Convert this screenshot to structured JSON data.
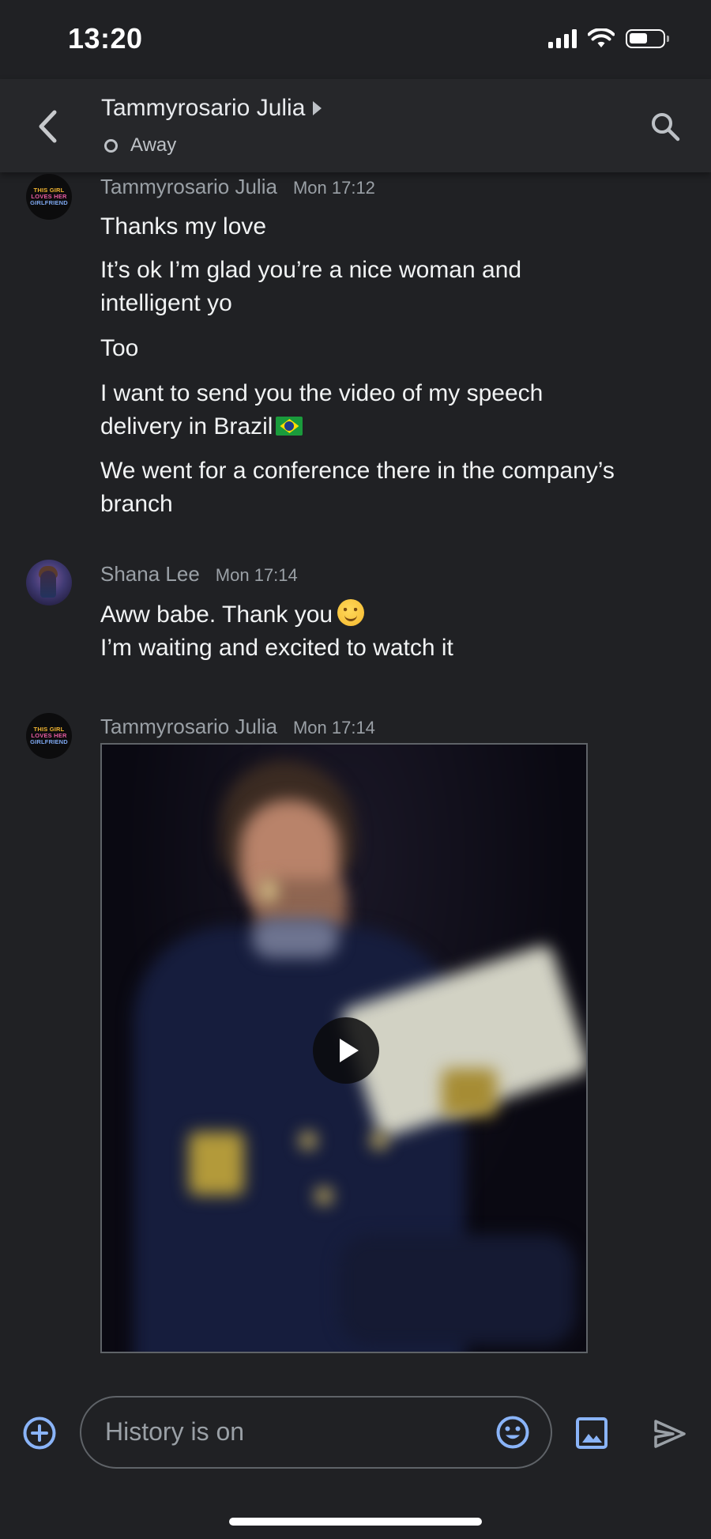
{
  "status_bar": {
    "time": "13:20"
  },
  "header": {
    "contact_name": "Tammyrosario Julia",
    "presence": "Away"
  },
  "messages": [
    {
      "sender": "Tammyrosario Julia",
      "avatar_text": [
        "THIS GIRL",
        "LOVES HER",
        "GIRLFRIEND"
      ],
      "time": "Mon 17:12",
      "lines": [
        "Thanks my love",
        "It’s ok I’m glad you’re a nice woman and intelligent yo",
        "Too",
        "I want to send you the video of my speech delivery in Brazil",
        "We went for a conference there in the company’s branch"
      ]
    },
    {
      "sender": "Shana Lee",
      "time": "Mon 17:14",
      "lines": [
        "Aww babe. Thank you",
        "I’m waiting  and excited to watch it"
      ]
    },
    {
      "sender": "Tammyrosario Julia",
      "avatar_text": [
        "THIS GIRL",
        "LOVES HER",
        "GIRLFRIEND"
      ],
      "time": "Mon 17:14",
      "attachment": "video"
    }
  ],
  "composer": {
    "placeholder": "History is on"
  },
  "icons": {
    "back": "chevron-left-icon",
    "search": "search-icon",
    "add": "plus-circle-icon",
    "emoji": "emoji-icon",
    "image": "image-icon",
    "send": "send-icon",
    "play": "play-icon"
  },
  "colors": {
    "background": "#202124",
    "header": "#26272a",
    "accent": "#8ab4f8",
    "text": "#f1f3f4",
    "muted": "#9aa0a6"
  }
}
